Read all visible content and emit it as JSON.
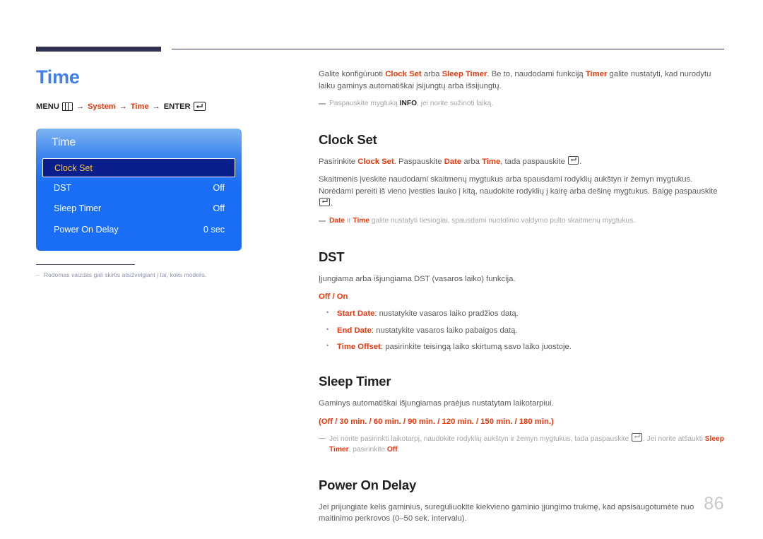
{
  "page": {
    "title": "Time",
    "number": "86"
  },
  "breadcrumb": {
    "menu_label": "MENU",
    "menu_icon": "menu-grid-icon",
    "arrow": "→",
    "item1": "System",
    "item2": "Time",
    "enter_label": "ENTER",
    "enter_icon": "enter-key-icon"
  },
  "osd": {
    "title": "Time",
    "rows": [
      {
        "label": "Clock Set",
        "value": "",
        "selected": true
      },
      {
        "label": "DST",
        "value": "Off",
        "selected": false
      },
      {
        "label": "Sleep Timer",
        "value": "Off",
        "selected": false
      },
      {
        "label": "Power On Delay",
        "value": "0 sec",
        "selected": false
      }
    ]
  },
  "left_note": {
    "dash": "–",
    "text": "Rodomas vaizdas gali skirtis atsižvelgiant į tai, koks modelis."
  },
  "intro": {
    "p1_a": "Galite konfigūruoti ",
    "p1_b1": "Clock Set",
    "p1_c": " arba ",
    "p1_b2": "Sleep Timer",
    "p1_d": ". Be to, naudodami funkciją ",
    "p1_b3": "Timer",
    "p1_e": " galite nustatyti, kad nurodytu laiku gaminys automatiškai įsijungtų arba išsijungtų.",
    "note_a": "Paspauskite mygtuką ",
    "note_b": "INFO",
    "note_c": ", jei norite sužinoti laiką."
  },
  "clock_set": {
    "heading": "Clock Set",
    "p1_a": "Pasirinkite ",
    "p1_b1": "Clock Set",
    "p1_c": ". Paspauskite ",
    "p1_b2": "Date",
    "p1_d": " arba ",
    "p1_b3": "Time",
    "p1_e": ", tada paspauskite ",
    "p1_f": ".",
    "p2_a": "Skaitmenis įveskite naudodami skaitmenų mygtukus arba spausdami rodyklių aukštyn ir žemyn mygtukus. Norėdami pereiti iš vieno įvesties lauko į kitą, naudokite rodyklių į kairę arba dešinę mygtukus. Baigę paspauskite ",
    "p2_b": ".",
    "note_b1": "Date",
    "note_a": " ir ",
    "note_b2": "Time",
    "note_c": " galite nustatyti tiesiogiai, spausdami nuotolinio valdymo pulto skaitmenų mygtukus."
  },
  "dst": {
    "heading": "DST",
    "p1": "Įjungiama arba išjungiama DST (vasaros laiko) funkcija.",
    "options": "Off / On",
    "bullets": [
      {
        "term": "Start Date",
        "desc": ": nustatykite vasaros laiko pradžios datą."
      },
      {
        "term": "End Date",
        "desc": ": nustatykite vasaros laiko pabaigos datą."
      },
      {
        "term": "Time Offset",
        "desc": ": pasirinkite teisingą laiko skirtumą savo laiko juostoje."
      }
    ]
  },
  "sleep_timer": {
    "heading": "Sleep Timer",
    "p1": "Gaminys automatiškai išjungiamas praėjus nustatytam laikotarpiui.",
    "options": "(Off / 30 min. / 60 min. / 90 min. / 120 min. / 150 min. / 180 min.)",
    "note_a": "Jei norite pasirinkti laikotarpį, naudokite rodyklių aukštyn ir žemyn mygtukus, tada paspauskite ",
    "note_b": ". Jei norite atšaukti ",
    "note_c": "Sleep Timer",
    "note_d": ", pasirinkite ",
    "note_e": "Off",
    "note_f": "."
  },
  "power_on_delay": {
    "heading": "Power On Delay",
    "p1": "Jei prijungiate kelis gaminius, sureguliuokite kiekvieno gaminio įjungimo trukmę, kad apsisaugotumėte nuo maitinimo perkrovos (0–50 sek. intervalu)."
  },
  "colors": {
    "accent_blue": "#4080e8",
    "accent_red": "#e8380d",
    "osd_blue": "#1a6ef5",
    "osd_selected": "#0a1f8c",
    "osd_selected_text": "#ffc82e",
    "rule_navy": "#2f3250"
  }
}
